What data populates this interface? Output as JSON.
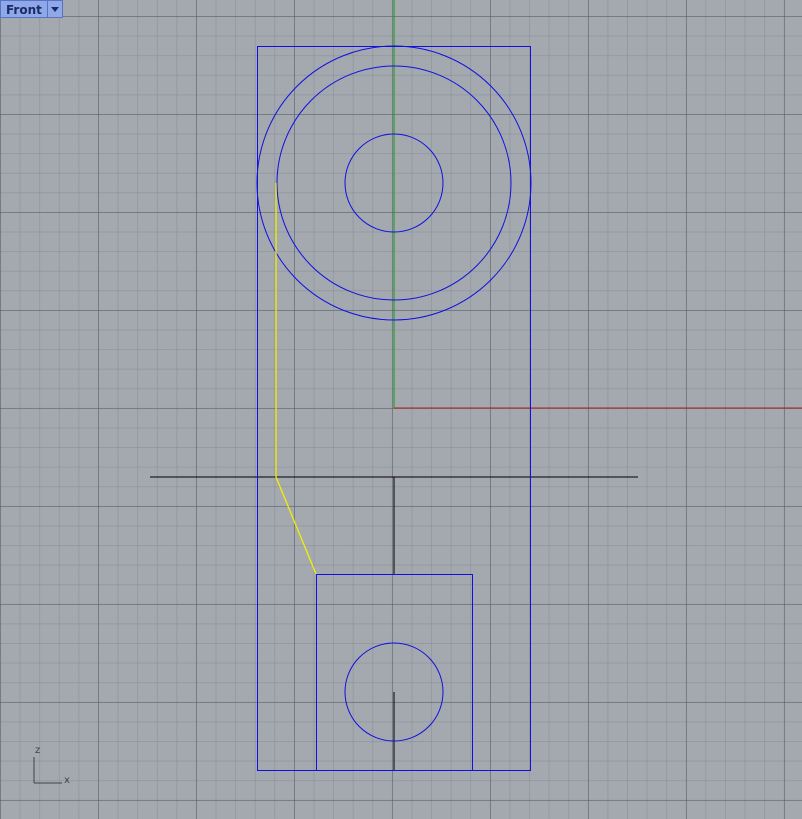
{
  "viewport": {
    "name": "Front",
    "menu_icon": "caret-down-icon"
  },
  "axis_widget": {
    "vertical_label": "z",
    "horizontal_label": "x"
  },
  "colors": {
    "background": "#a4a9b0",
    "curves": "#1010e0",
    "selected_curve": "#f0f000",
    "x_axis": "#b02020",
    "z_axis": "#10a010",
    "construction_lines": "#000000"
  }
}
